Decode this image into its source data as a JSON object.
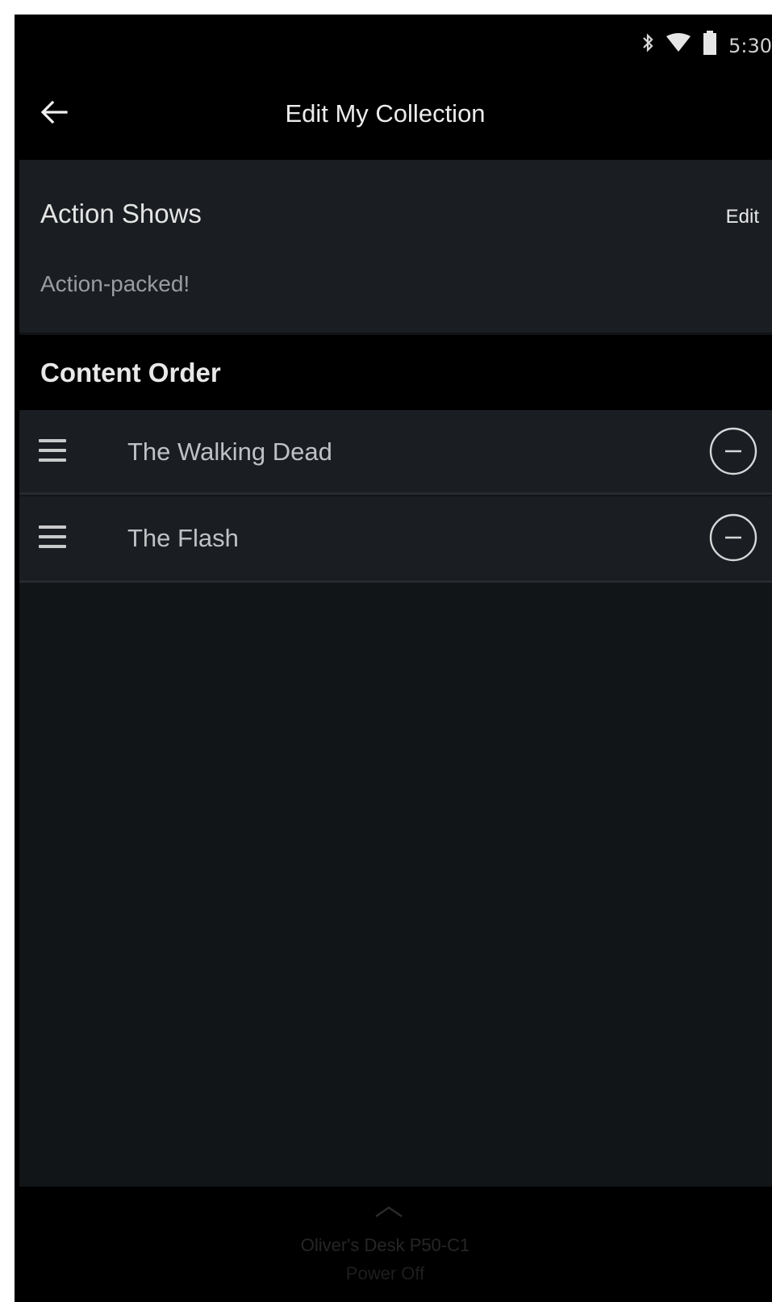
{
  "status_bar": {
    "time": "5:30",
    "icons": [
      "bluetooth-icon",
      "wifi-icon",
      "battery-icon"
    ]
  },
  "app_bar": {
    "title": "Edit My Collection",
    "back_icon": "arrow-left-icon"
  },
  "collection": {
    "name": "Action Shows",
    "edit_label": "Edit",
    "description": "Action-packed!"
  },
  "content_order": {
    "header": "Content Order",
    "items": [
      {
        "title": "The Walking Dead"
      },
      {
        "title": "The Flash"
      }
    ]
  },
  "bottom_bar": {
    "device_name": "Oliver's Desk P50-C1",
    "device_status": "Power Off"
  },
  "colors": {
    "background": "#000000",
    "card": "#1a1d21",
    "list_bg": "#121518",
    "text_primary": "#e4e4e4",
    "text_secondary": "#9a9ca0"
  }
}
